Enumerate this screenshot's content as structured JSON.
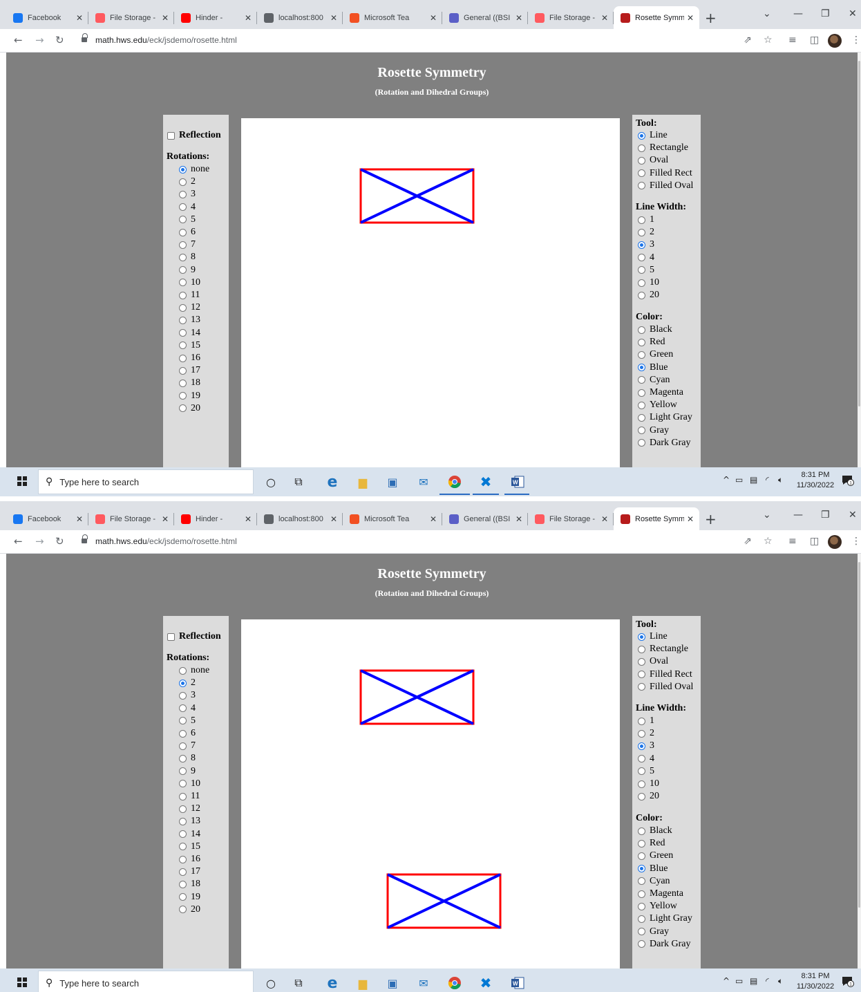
{
  "browser": {
    "tabs": [
      {
        "title": "Facebook",
        "favicon": "facebook-icon",
        "color": "#1877f2"
      },
      {
        "title": "File Storage -",
        "favicon": "laravel-icon",
        "color": "#ff5a5f"
      },
      {
        "title": "Hinder -",
        "favicon": "youtube-icon",
        "color": "#ff0000"
      },
      {
        "title": "localhost:800",
        "favicon": "globe-icon",
        "color": "#5f6368"
      },
      {
        "title": "Microsoft Tea",
        "favicon": "microsoft-icon",
        "color": "#f25022"
      },
      {
        "title": "General ((BSI",
        "favicon": "teams-icon",
        "color": "#5b5fc7"
      },
      {
        "title": "File Storage -",
        "favicon": "laravel-icon",
        "color": "#ff5a5f"
      },
      {
        "title": "Rosette Symm",
        "favicon": "rosette-icon",
        "color": "#b71c1c"
      }
    ],
    "url_host": "math.hws.edu",
    "url_path": "/eck/jsdemo/rosette.html"
  },
  "page": {
    "title": "Rosette Symmetry",
    "subtitle": "(Rotation and Dihedral Groups)",
    "reflection_label": "Reflection",
    "rotations_header": "Rotations:",
    "rotations_options": [
      "none",
      "2",
      "3",
      "4",
      "5",
      "6",
      "7",
      "8",
      "9",
      "10",
      "11",
      "12",
      "13",
      "14",
      "15",
      "16",
      "17",
      "18",
      "19",
      "20"
    ],
    "tool_header": "Tool:",
    "tool_options": [
      "Line",
      "Rectangle",
      "Oval",
      "Filled Rect",
      "Filled Oval"
    ],
    "line_width_header": "Line Width:",
    "line_width_options": [
      "1",
      "2",
      "3",
      "4",
      "5",
      "10",
      "20"
    ],
    "color_header": "Color:",
    "color_options": [
      "Black",
      "Red",
      "Green",
      "Blue",
      "Cyan",
      "Magenta",
      "Yellow",
      "Light Gray",
      "Gray",
      "Dark Gray"
    ],
    "rectangle_color": "#ff0000",
    "line_color": "#0000ff"
  },
  "states": [
    {
      "reflection": false,
      "rotation": "none",
      "tool": "Line",
      "line_width": "3",
      "color": "Blue"
    },
    {
      "reflection": false,
      "rotation": "2",
      "tool": "Line",
      "line_width": "3",
      "color": "Blue"
    }
  ],
  "taskbar": {
    "search_placeholder": "Type here to search",
    "time": "8:31 PM",
    "date": "11/30/2022",
    "notification_count": "1"
  }
}
